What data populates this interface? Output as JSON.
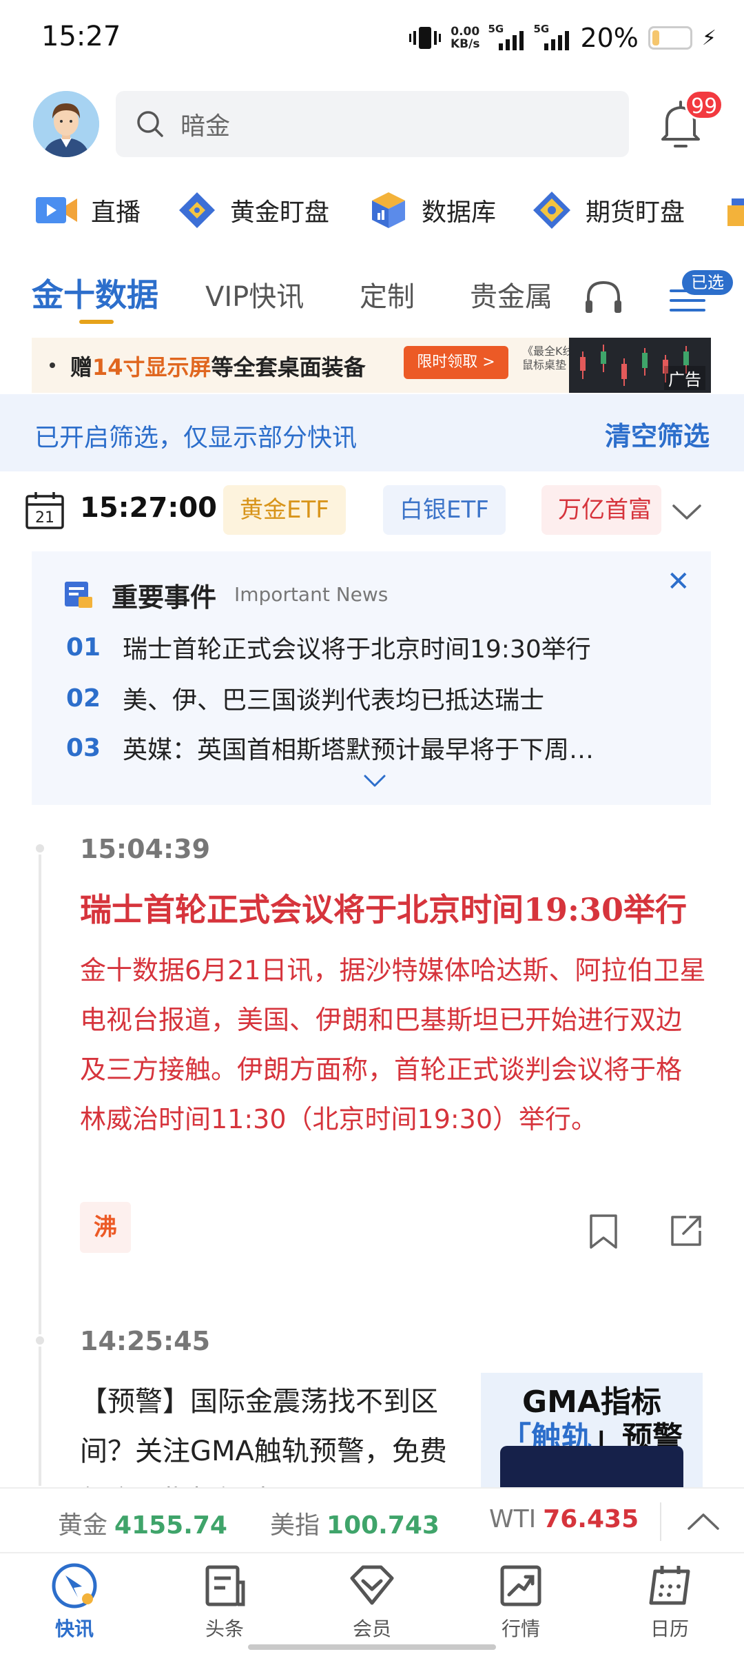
{
  "status_bar": {
    "time": "15:27",
    "net_speed": "0.00",
    "net_unit": "KB/s",
    "sim1": "5G",
    "sim2": "5G",
    "battery": "20%"
  },
  "header": {
    "search_placeholder": "暗金",
    "notification_count": "99"
  },
  "quick_nav": [
    {
      "label": "直播",
      "icon": "video-icon"
    },
    {
      "label": "黄金盯盘",
      "icon": "gold-diamond-icon"
    },
    {
      "label": "数据库",
      "icon": "database-cube-icon"
    },
    {
      "label": "期货盯盘",
      "icon": "futures-diamond-icon"
    }
  ],
  "tabs": {
    "items": [
      "金十数据",
      "VIP快讯",
      "定制",
      "贵金属"
    ],
    "active": "金十数据",
    "filter_badge": "已选"
  },
  "ad": {
    "text_pre": "赠",
    "text_highlight": "14寸显示屏",
    "text_post": "等全套桌面装备",
    "button": "限时领取 >",
    "mini_line1": "《最全K线》",
    "mini_line2": "鼠标桌垫",
    "label": "广告"
  },
  "filter_bar": {
    "message": "已开启筛选，仅显示部分快讯",
    "clear": "清空筛选"
  },
  "date_row": {
    "day": "21",
    "current_time": "15:27:00",
    "chips": [
      "黄金ETF",
      "白银ETF",
      "万亿首富"
    ]
  },
  "important_news": {
    "title": "重要事件",
    "subtitle": "Important News",
    "items": [
      {
        "num": "01",
        "text": "瑞士首轮正式会议将于北京时间19:30举行"
      },
      {
        "num": "02",
        "text": "美、伊、巴三国谈判代表均已抵达瑞士"
      },
      {
        "num": "03",
        "text": "英媒：英国首相斯塔默预计最早将于下周…"
      }
    ]
  },
  "feed": [
    {
      "time": "15:04:39",
      "headline": "瑞士首轮正式会议将于北京时间19:30举行",
      "body": "金十数据6月21日讯，据沙特媒体哈达斯、阿拉伯卫星电视台报道，美国、伊朗和巴基斯坦已开始进行双边及三方接触。伊朗方面称，首轮正式谈判会议将于格林威治时间11:30（北京时间19:30）举行。",
      "tag": "沸"
    },
    {
      "time": "14:25:45",
      "text": "【预警】国际金震荡找不到区间？关注GMA触轨预警，免费领今日指标解读 >",
      "image_title": "GMA指标",
      "image_title2_pre": "「",
      "image_title2_hl": "触轨",
      "image_title2_post": "」预警"
    }
  ],
  "ticker": [
    {
      "name": "黄金",
      "value": "4155.74",
      "trend": "up"
    },
    {
      "name": "美指",
      "value": "100.743",
      "trend": "up"
    },
    {
      "name": "WTI",
      "value": "76.435",
      "trend": "down"
    }
  ],
  "bottom_nav": [
    {
      "label": "快讯",
      "active": true
    },
    {
      "label": "头条",
      "active": false
    },
    {
      "label": "会员",
      "active": false
    },
    {
      "label": "行情",
      "active": false
    },
    {
      "label": "日历",
      "active": false
    }
  ],
  "colors": {
    "accent_blue": "#2c6ecb",
    "news_red": "#d6343c",
    "gold": "#e6a21a",
    "up_green": "#3fa46a"
  }
}
